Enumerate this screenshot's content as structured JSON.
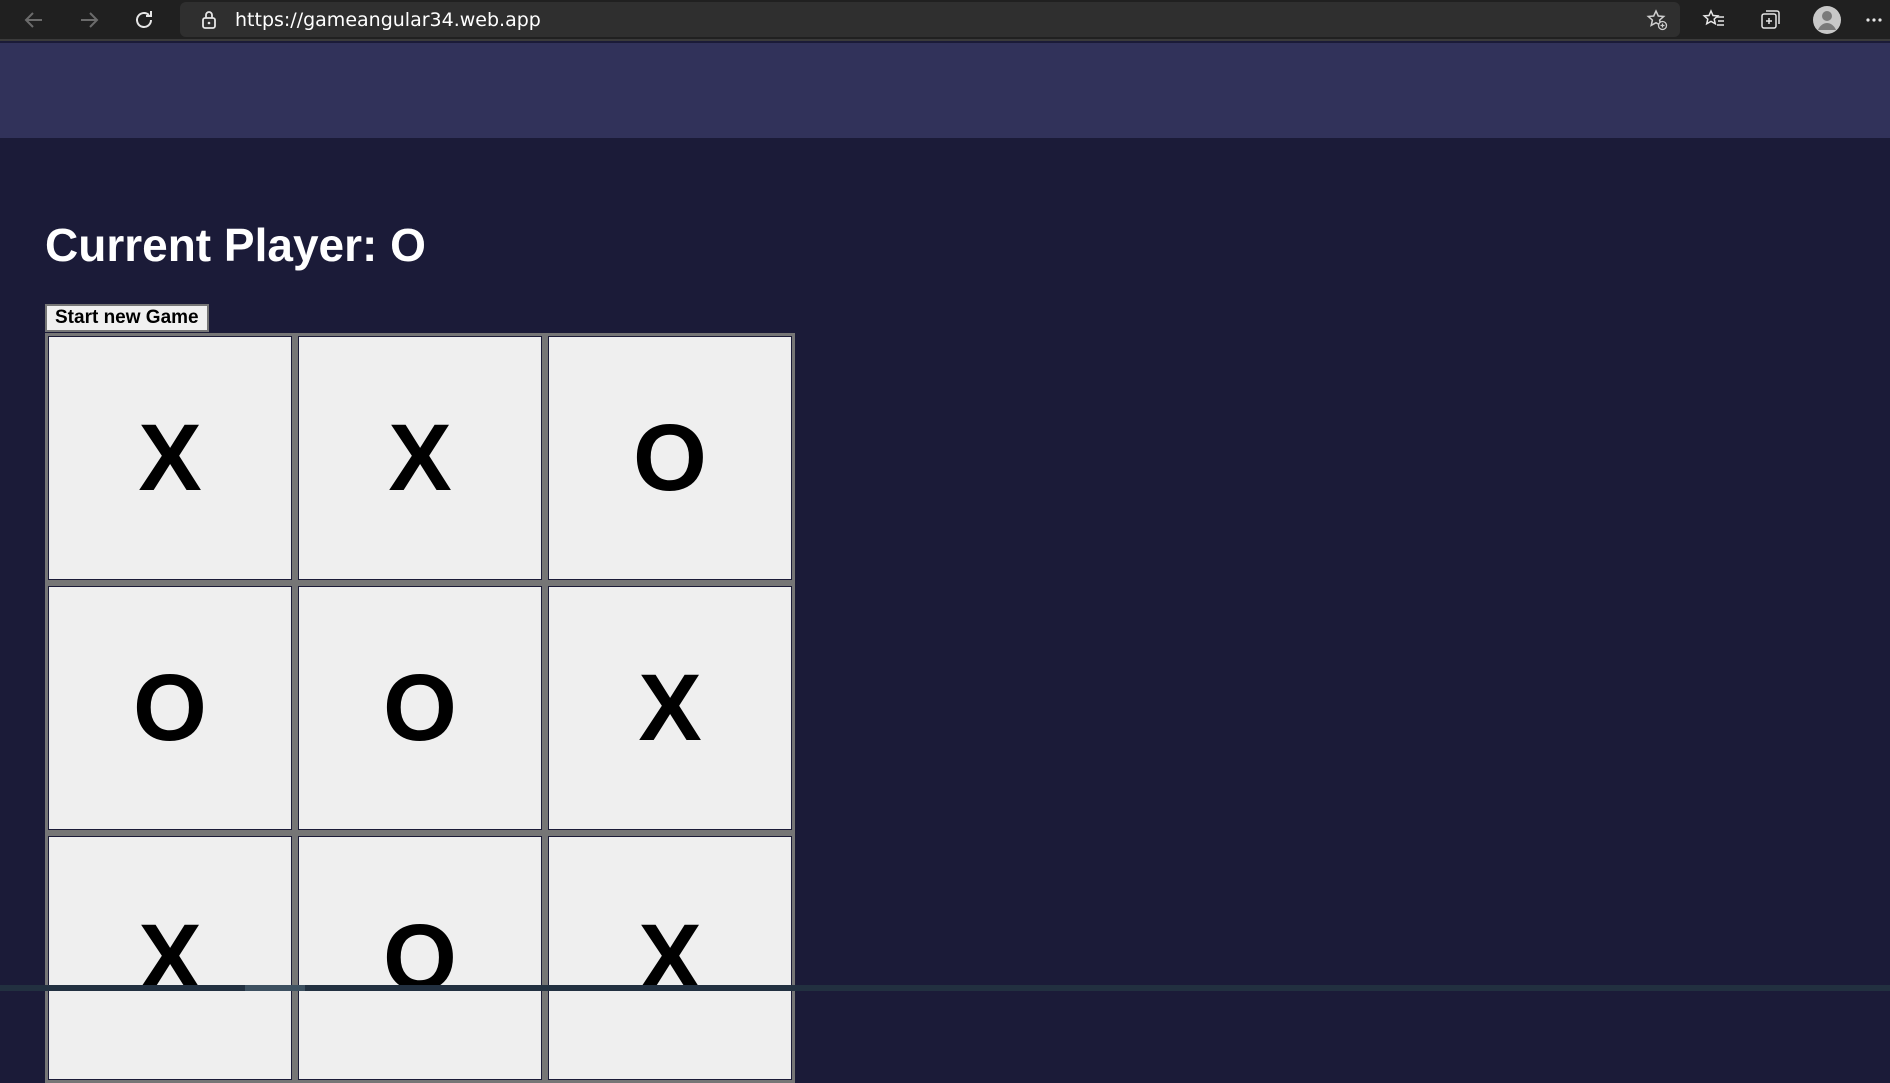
{
  "browser": {
    "url": "https://gameangular34.web.app"
  },
  "game": {
    "current_player_label": "Current Player: O",
    "new_game_label": "Start new Game",
    "board": [
      "X",
      "X",
      "O",
      "O",
      "O",
      "X",
      "X",
      "O",
      "X"
    ]
  },
  "colors": {
    "header": "#31325a",
    "background": "#1b1b38",
    "cell": "#efefef"
  }
}
